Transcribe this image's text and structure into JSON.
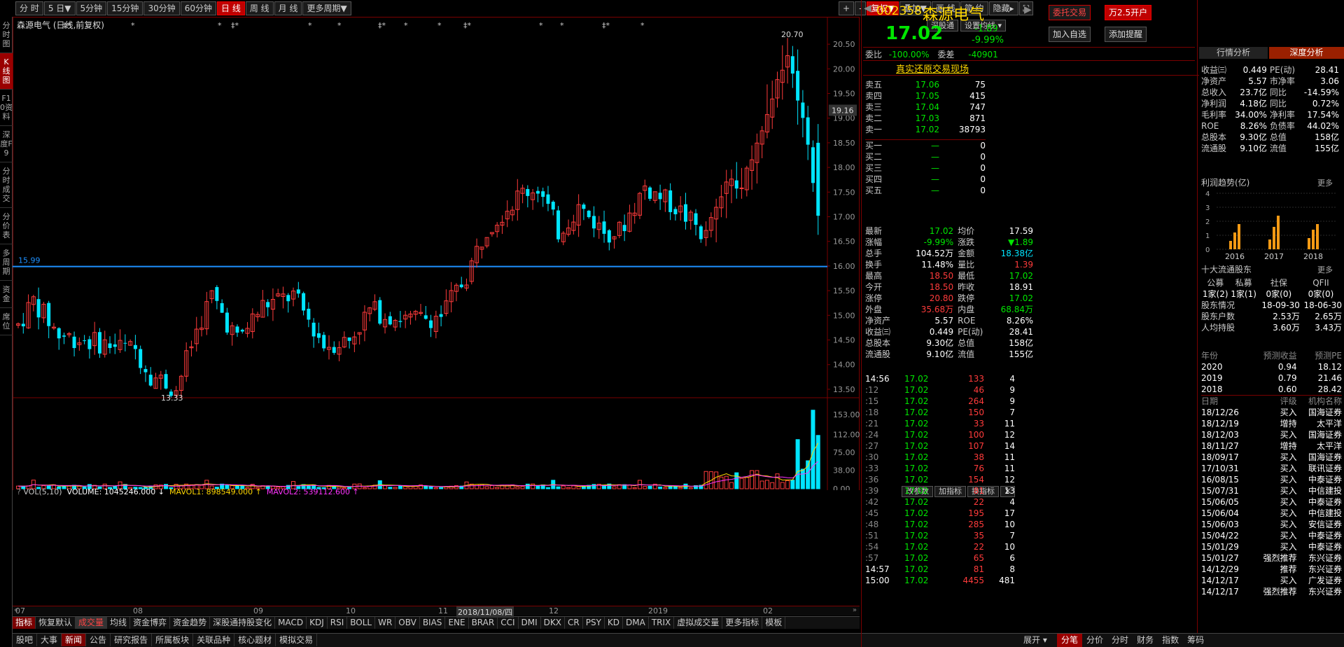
{
  "toolbar": {
    "periods": [
      "分 时",
      "5 日▼",
      "5分钟",
      "15分钟",
      "30分钟",
      "60分钟",
      "日 线",
      "周 线",
      "月 线",
      "更多周期▼"
    ],
    "active_period": "日 线",
    "tools": [
      "+",
      "-",
      "复权▼",
      "叠加▼",
      "画 线",
      "简 约",
      "隐藏▸",
      "⛶"
    ]
  },
  "left_tabs": [
    "分时图",
    "K线图",
    "F10资料",
    "深度F9",
    "分时成交",
    "分价表",
    "多周期",
    "资金",
    "席位"
  ],
  "chart": {
    "title": "森源电气 (日线,前复权)",
    "btn_sgt": "深股通",
    "btn_ma": "设置均线 ▾",
    "price_ticks": [
      "20.50",
      "20.00",
      "19.50",
      "19.00",
      "18.50",
      "18.00",
      "17.50",
      "17.00",
      "16.50",
      "16.00",
      "15.50",
      "15.00",
      "14.50",
      "14.00",
      "13.50"
    ],
    "current_price_tag": "19.16",
    "hline_label": "15.99",
    "high_label": "20.70",
    "low_label": "13.33",
    "x_labels": [
      "07",
      "08",
      "09",
      "10",
      "11",
      "12",
      "2019",
      "02"
    ],
    "crosshair_date": "2018/11/08/四"
  },
  "volume": {
    "legend_prefix": "VOL(5,10)",
    "volume": "VOLUME: 1045246.000 ↓",
    "mavol1": "MAVOL1: 898549.000 ↑",
    "mavol2": "MAVOL2: 539112.600 ↑",
    "btns": [
      "改参数",
      "加指标",
      "换指标",
      "✕"
    ],
    "ticks": [
      "153.00",
      "112.00",
      "75.00",
      "38.00",
      "0.00"
    ]
  },
  "chart_data": {
    "type": "candlestick",
    "title": "森源电气 (日线,前复权)",
    "ylim": [
      13.3,
      20.8
    ],
    "volume_ylim": [
      0,
      153
    ],
    "x_month_labels": [
      "07",
      "08",
      "09",
      "10",
      "11",
      "12",
      "2019",
      "02"
    ],
    "high": 20.7,
    "low": 13.33,
    "reference_line": 15.99,
    "last_close": 17.02
  },
  "indicator_tabs": [
    "指标",
    "恢复默认",
    "成交量",
    "均线",
    "资金博弈",
    "资金趋势",
    "深股通持股变化",
    "MACD",
    "KDJ",
    "RSI",
    "BOLL",
    "WR",
    "OBV",
    "BIAS",
    "ENE",
    "BRAR",
    "CCI",
    "DMI",
    "DKX",
    "CR",
    "PSY",
    "KD",
    "DMA",
    "TRIX",
    "虚拟成交量",
    "更多指标",
    "模板"
  ],
  "bottom_tabs": [
    "股吧",
    "大事",
    "新闻",
    "公告",
    "研究报告",
    "所属板块",
    "关联品种",
    "核心题材",
    "模拟交易"
  ],
  "bottom_right": "展开 ▾",
  "quote": {
    "code": "002358",
    "name": "森源电气",
    "price": "17.02",
    "change": "-1.89",
    "change_pct": "-9.99%",
    "btn_entrust": "委托交易",
    "btn_open": "万2.5开户",
    "btn_watch": "加入自选",
    "btn_alert": "添加提醒",
    "webi_label": "委比",
    "webi": "-100.00%",
    "weicha_label": "委差",
    "weicha": "-40901",
    "replay": "真实还原交易现场",
    "sells": [
      [
        "卖五",
        "17.06",
        "75"
      ],
      [
        "卖四",
        "17.05",
        "415"
      ],
      [
        "卖三",
        "17.04",
        "747"
      ],
      [
        "卖二",
        "17.03",
        "871"
      ],
      [
        "卖一",
        "17.02",
        "38793"
      ]
    ],
    "buys": [
      [
        "买一",
        "—",
        "0"
      ],
      [
        "买二",
        "—",
        "0"
      ],
      [
        "买三",
        "—",
        "0"
      ],
      [
        "买四",
        "—",
        "0"
      ],
      [
        "买五",
        "—",
        "0"
      ]
    ],
    "info": [
      [
        "最新",
        "17.02",
        "均价",
        "17.59"
      ],
      [
        "涨幅",
        "-9.99%",
        "涨跌",
        "▼1.89"
      ],
      [
        "总手",
        "104.52万",
        "金额",
        "18.38亿"
      ],
      [
        "换手",
        "11.48%",
        "量比",
        "1.39"
      ],
      [
        "最高",
        "18.50",
        "最低",
        "17.02"
      ],
      [
        "今开",
        "18.50",
        "昨收",
        "18.91"
      ],
      [
        "涨停",
        "20.80",
        "跌停",
        "17.02"
      ],
      [
        "外盘",
        "35.68万",
        "内盘",
        "68.84万"
      ],
      [
        "净资产",
        "5.57",
        "ROE",
        "8.26%"
      ],
      [
        "收益㈢",
        "0.449",
        "PE(动)",
        "28.41"
      ],
      [
        "总股本",
        "9.30亿",
        "总值",
        "158亿"
      ],
      [
        "流通股",
        "9.10亿",
        "流值",
        "155亿"
      ]
    ]
  },
  "trades": [
    [
      "14:56",
      "17.02",
      "133",
      "4"
    ],
    [
      ":12",
      "17.02",
      "46",
      "9"
    ],
    [
      ":15",
      "17.02",
      "264",
      "9"
    ],
    [
      ":18",
      "17.02",
      "150",
      "7"
    ],
    [
      ":21",
      "17.02",
      "33",
      "11"
    ],
    [
      ":24",
      "17.02",
      "100",
      "12"
    ],
    [
      ":27",
      "17.02",
      "107",
      "14"
    ],
    [
      ":30",
      "17.02",
      "38",
      "11"
    ],
    [
      ":33",
      "17.02",
      "76",
      "11"
    ],
    [
      ":36",
      "17.02",
      "154",
      "12"
    ],
    [
      ":39",
      "17.02",
      "81",
      "13"
    ],
    [
      ":42",
      "17.02",
      "22",
      "4"
    ],
    [
      ":45",
      "17.02",
      "195",
      "17"
    ],
    [
      ":48",
      "17.02",
      "285",
      "10"
    ],
    [
      ":51",
      "17.02",
      "35",
      "7"
    ],
    [
      ":54",
      "17.02",
      "22",
      "10"
    ],
    [
      ":57",
      "17.02",
      "65",
      "6"
    ],
    [
      "14:57",
      "17.02",
      "81",
      "8"
    ],
    [
      "15:00",
      "17.02",
      "4455",
      "481"
    ]
  ],
  "analysis": {
    "tab1": "行情分析",
    "tab2": "深度分析",
    "fin": [
      [
        "收益㈢",
        "0.449",
        "PE(动)",
        "28.41"
      ],
      [
        "净资产",
        "5.57",
        "市净率",
        "3.06"
      ],
      [
        "总收入",
        "23.7亿",
        "同比",
        "-14.59%"
      ],
      [
        "净利润",
        "4.18亿",
        "同比",
        "0.72%"
      ],
      [
        "毛利率",
        "34.00%",
        "净利率",
        "17.54%"
      ],
      [
        "ROE",
        "8.26%",
        "负债率",
        "44.02%"
      ],
      [
        "总股本",
        "9.30亿",
        "总值",
        "158亿"
      ],
      [
        "流通股",
        "9.10亿",
        "流值",
        "155亿"
      ]
    ],
    "profit_title": "利润趋势(亿)",
    "more": "更多",
    "profit_years": [
      "2016",
      "2017",
      "2018"
    ],
    "profit_ylabels": [
      "4",
      "3",
      "2",
      "1",
      "0"
    ],
    "profit_bars": [
      [
        0.6,
        1.2,
        1.8
      ],
      [
        0.7,
        1.6,
        2.4
      ],
      [
        0.8,
        1.4,
        1.8
      ]
    ],
    "holders_title": "十大流通股东",
    "holders_more": "更多",
    "holders_head": [
      "公募",
      "私募",
      "社保",
      "QFII"
    ],
    "holders_vals": [
      "1家(2)",
      "1家(1)",
      "0家(0)",
      "0家(0)"
    ],
    "holder_rows": [
      [
        "股东情况",
        "18-09-30",
        "18-06-30"
      ],
      [
        "股东户数",
        "2.53万",
        "2.65万"
      ],
      [
        "人均持股",
        "3.60万",
        "3.43万"
      ]
    ],
    "forecast_head": [
      "年份",
      "预测收益",
      "预测PE"
    ],
    "forecast": [
      [
        "2020",
        "0.94",
        "18.12"
      ],
      [
        "2019",
        "0.79",
        "21.46"
      ],
      [
        "2018",
        "0.60",
        "28.42"
      ]
    ],
    "rating_head": [
      "日期",
      "评级",
      "机构名称"
    ],
    "ratings": [
      [
        "18/12/26",
        "买入",
        "国海证券"
      ],
      [
        "18/12/19",
        "增持",
        "太平洋"
      ],
      [
        "18/12/03",
        "买入",
        "国海证券"
      ],
      [
        "18/11/27",
        "增持",
        "太平洋"
      ],
      [
        "18/09/17",
        "买入",
        "国海证券"
      ],
      [
        "17/10/31",
        "买入",
        "联讯证券"
      ],
      [
        "16/08/15",
        "买入",
        "中泰证券"
      ],
      [
        "15/07/31",
        "买入",
        "中信建投"
      ],
      [
        "15/06/05",
        "买入",
        "中泰证券"
      ],
      [
        "15/06/04",
        "买入",
        "中信建投"
      ],
      [
        "15/06/03",
        "买入",
        "安信证券"
      ],
      [
        "15/04/22",
        "买入",
        "中泰证券"
      ],
      [
        "15/01/29",
        "买入",
        "中泰证券"
      ],
      [
        "15/01/27",
        "强烈推荐",
        "东兴证券"
      ],
      [
        "14/12/29",
        "推荐",
        "东兴证券"
      ],
      [
        "14/12/17",
        "买入",
        "广发证券"
      ],
      [
        "14/12/17",
        "强烈推荐",
        "东兴证券"
      ]
    ]
  },
  "bottom_right_tabs": [
    "分笔",
    "分价",
    "分时",
    "财务",
    "指数",
    "筹码"
  ],
  "colors": {
    "up": "#ff3b3b",
    "down": "#00e5ff",
    "accent": "#c00000",
    "ref_line": "#1e90ff"
  }
}
